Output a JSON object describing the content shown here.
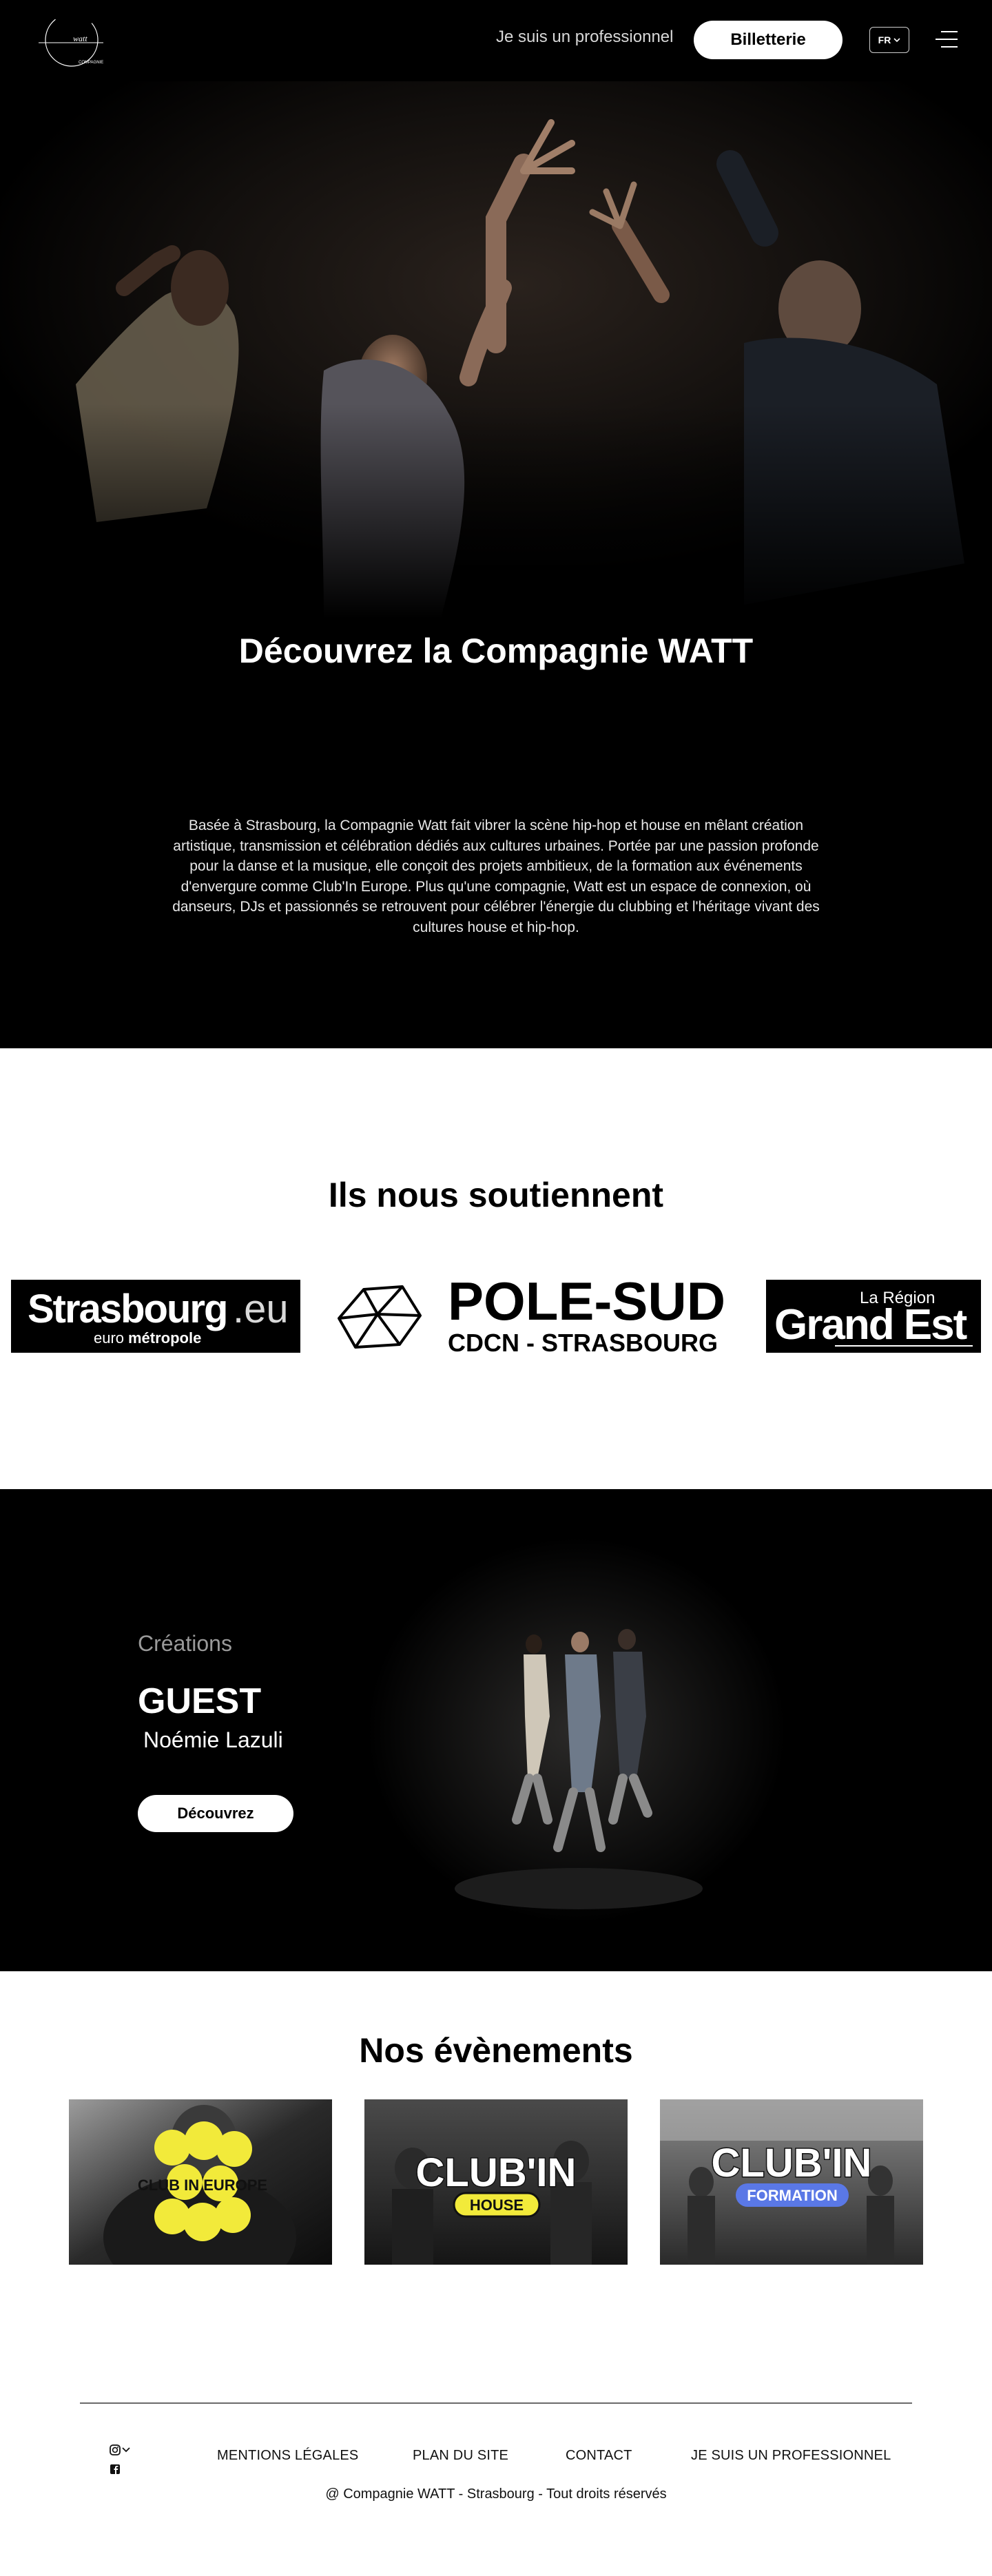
{
  "header": {
    "logo_text": "watt",
    "logo_subtext": "COMPAGNIE",
    "pro_link": "Je suis un professionnel",
    "ticket_button": "Billetterie",
    "lang": "FR"
  },
  "hero": {
    "title": "Découvrez la Compagnie WATT",
    "text": "Basée à Strasbourg, la Compagnie Watt fait vibrer la scène hip-hop et house en mêlant création artistique, transmission et célébration dédiés aux cultures urbaines. Portée par une passion profonde pour la danse et la musique, elle conçoit des projets ambitieux, de la formation aux événements d'envergure comme Club'In Europe. Plus qu'une compagnie, Watt est un espace de connexion, où danseurs, DJs et passionnés se retrouvent pour célébrer l'énergie du clubbing et l'héritage vivant des cultures house et hip-hop."
  },
  "supporters": {
    "title": "Ils nous soutiennent",
    "logos": [
      {
        "line1": "Strasbourg",
        "line1_suffix": ".eu",
        "line2_a": "euro",
        "line2_b": "métropole"
      },
      {
        "line1": "POLE-SUD",
        "line2": "CDCN - STRASBOURG"
      },
      {
        "line1": "La Région",
        "line2": "Grand Est"
      }
    ]
  },
  "creations": {
    "eyebrow": "Créations",
    "title": "GUEST",
    "author": "Noémie Lazuli",
    "button": "Découvrez"
  },
  "events": {
    "title": "Nos évènements",
    "cards": [
      {
        "logo": "CLUB IN EUROPE",
        "tag": ""
      },
      {
        "logo": "CLUB'IN",
        "tag": "HOUSE"
      },
      {
        "logo": "CLUB'IN",
        "tag": "FORMATION"
      }
    ]
  },
  "footer": {
    "links": [
      "MENTIONS LÉGALES",
      "PLAN DU SITE",
      "CONTACT",
      "JE SUIS UN PROFESSIONNEL"
    ],
    "copyright": "@ Compagnie WATT - Strasbourg - Tout droits réservés"
  },
  "colors": {
    "black": "#000000",
    "white": "#ffffff",
    "club_yellow": "#f2ea3a",
    "formation_blue": "#5a78e6"
  }
}
